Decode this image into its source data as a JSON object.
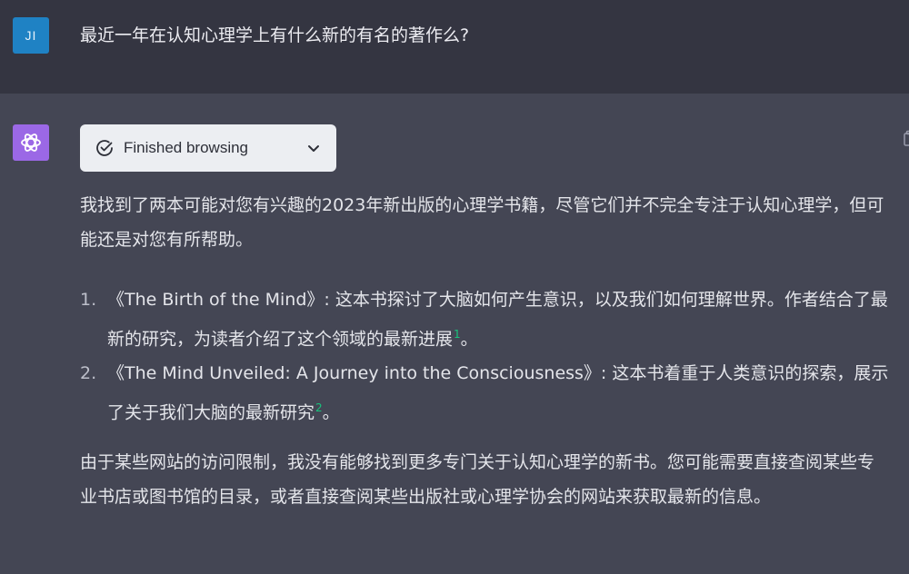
{
  "user": {
    "avatar_text": "JI",
    "message": "最近一年在认知心理学上有什么新的有名的著作么?"
  },
  "assistant": {
    "browsing_status": "Finished browsing",
    "intro": "我找到了两本可能对您有兴趣的2023年新出版的心理学书籍，尽管它们并不完全专注于认知心理学，但可能还是对您有所帮助。",
    "books": [
      {
        "number": "1.",
        "text": "《The Birth of the Mind》: 这本书探讨了大脑如何产生意识，以及我们如何理解世界。作者结合了最新的研究，为读者介绍了这个领域的最新进展",
        "citation": "1",
        "end": "。"
      },
      {
        "number": "2.",
        "text": "《The Mind Unveiled: A Journey into the Consciousness》: 这本书着重于人类意识的探索，展示了关于我们大脑的最新研究",
        "citation": "2",
        "end": "。"
      }
    ],
    "closing": "由于某些网站的访问限制，我没有能够找到更多专门关于认知心理学的新书。您可能需要直接查阅某些专业书店或图书馆的目录，或者直接查阅某些出版社或心理学协会的网站来获取最新的信息。"
  },
  "icons": {
    "check": "check-circle-icon",
    "chevron": "chevron-down-icon",
    "bot_logo": "openai-logo-icon",
    "copy": "clipboard-icon"
  },
  "colors": {
    "user_row_bg": "#343541",
    "assistant_row_bg": "#444654",
    "user_avatar": "#1f82c4",
    "bot_avatar": "#9b68e6",
    "citation": "#19c37d"
  }
}
